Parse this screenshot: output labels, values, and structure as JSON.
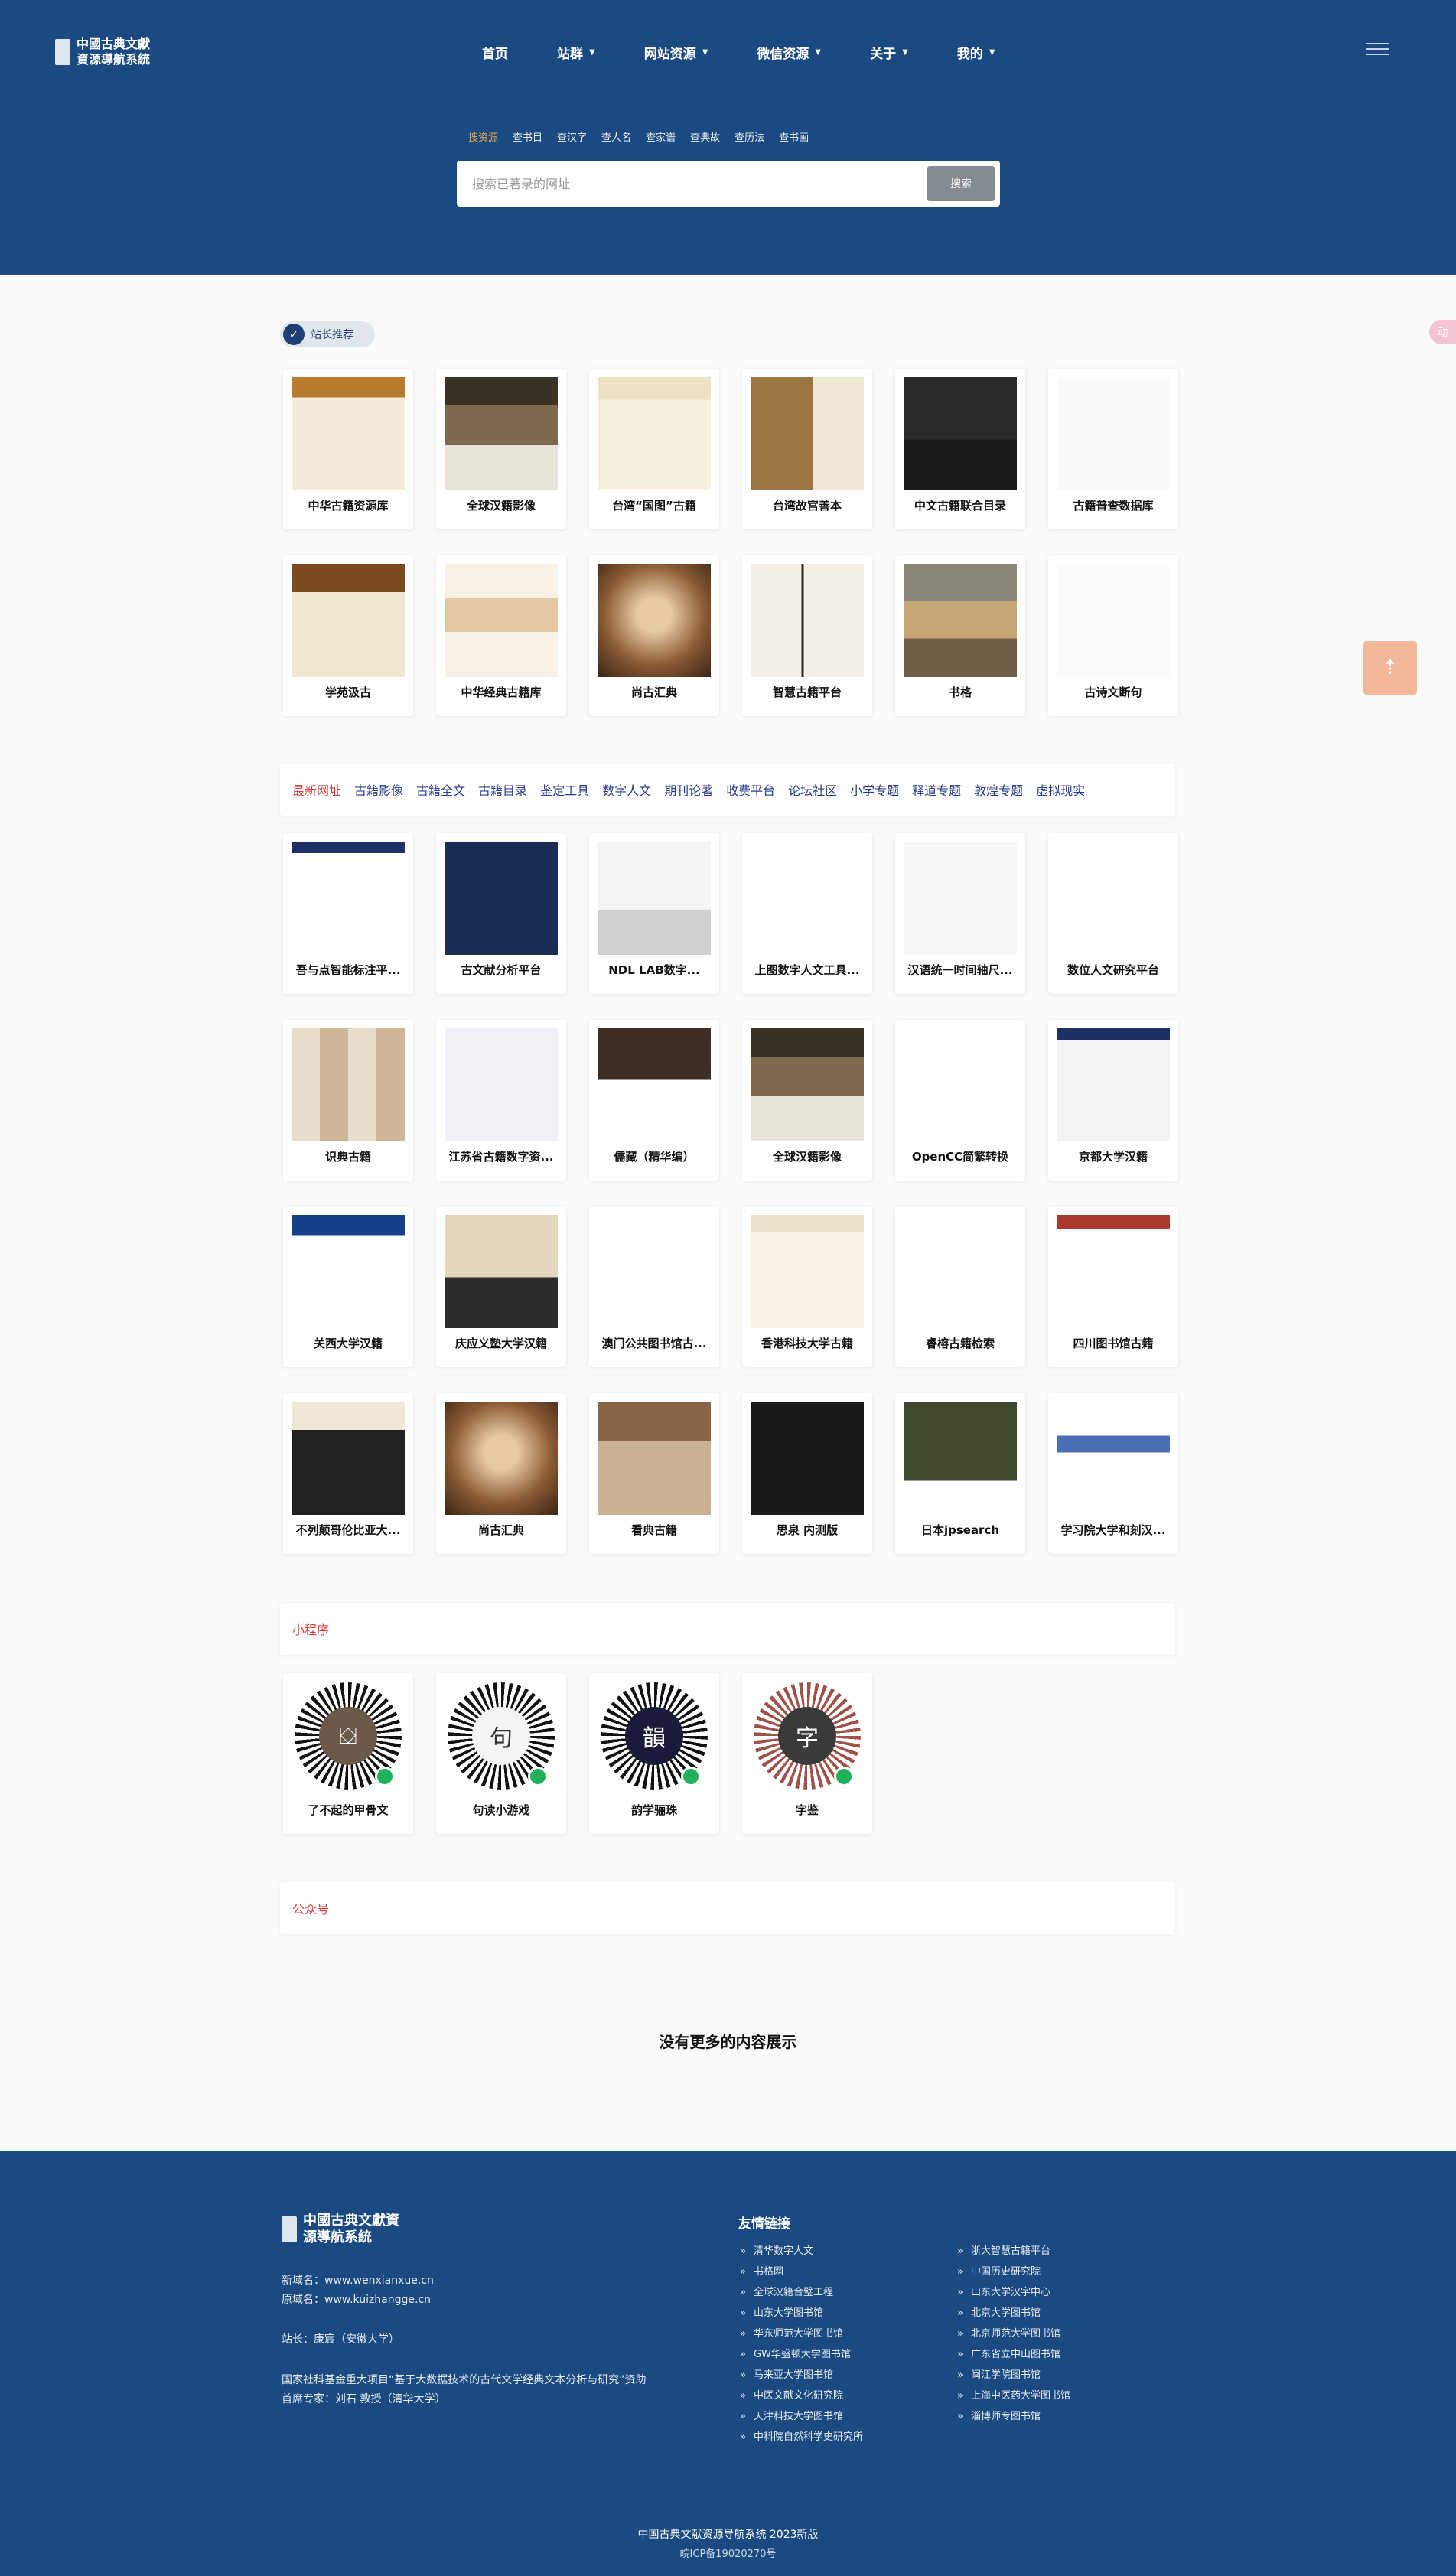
{
  "header": {
    "logo_text": "中國古典文獻資源導航系統",
    "nav": [
      {
        "label": "首页",
        "dropdown": false
      },
      {
        "label": "站群",
        "dropdown": true
      },
      {
        "label": "网站资源",
        "dropdown": true
      },
      {
        "label": "微信资源",
        "dropdown": true
      },
      {
        "label": "关于",
        "dropdown": true
      },
      {
        "label": "我的",
        "dropdown": true
      }
    ],
    "menu_icon": "hamburger-icon"
  },
  "search": {
    "tabs": [
      "搜资源",
      "查书目",
      "查汉字",
      "查人名",
      "查家谱",
      "查典故",
      "查历法",
      "查书画"
    ],
    "active_tab": 0,
    "placeholder": "搜索已著录的网址",
    "button": "搜索"
  },
  "recommend": {
    "badge": "站长推荐",
    "items": [
      "中华古籍资源库",
      "全球汉籍影像",
      "台湾“国图”古籍",
      "台湾故宫善本",
      "中文古籍联合目录",
      "古籍普查数据库",
      "学苑汲古",
      "中华经典古籍库",
      "尚古汇典",
      "智慧古籍平台",
      "书格",
      "古诗文断句"
    ]
  },
  "filters": {
    "tabs": [
      "最新网址",
      "古籍影像",
      "古籍全文",
      "古籍目录",
      "鉴定工具",
      "数字人文",
      "期刊论著",
      "收费平台",
      "论坛社区",
      "小学专题",
      "释道专题",
      "敦煌专题",
      "虚拟现实"
    ],
    "active": 0
  },
  "latest": {
    "items": [
      "吾与点智能标注平...",
      "古文献分析平台",
      "NDL LAB数字...",
      "上图数字人文工具...",
      "汉语统一时间轴尺...",
      "数位人文研究平台",
      "识典古籍",
      "江苏省古籍数字资...",
      "儒藏（精华编）",
      "全球汉籍影像",
      "OpenCC简繁转换",
      "京都大学汉籍",
      "关西大学汉籍",
      "庆应义塾大学汉籍",
      "澳门公共图书馆古...",
      "香港科技大学古籍",
      "睿榕古籍检索",
      "四川图书馆古籍",
      "不列颠哥伦比亚大...",
      "尚古汇典",
      "看典古籍",
      "思泉 内测版",
      "日本jpsearch",
      "学习院大学和刻汉..."
    ]
  },
  "mini": {
    "title": "小程序",
    "items": [
      {
        "label": "了不起的甲骨文",
        "glyph": "⛋",
        "color": "#6b5a4a"
      },
      {
        "label": "句读小游戏",
        "glyph": "句",
        "color": "#ffffff"
      },
      {
        "label": "韵学骊珠",
        "glyph": "韻",
        "color": "#1a1a3a"
      },
      {
        "label": "字鉴",
        "glyph": "字",
        "color": "#3a3a3a"
      }
    ]
  },
  "official": {
    "title": "公众号"
  },
  "no_more": "没有更多的内容展示",
  "footer": {
    "logo_text": "中國古典文獻資源導航系統",
    "lines": [
      "新域名：www.wenxianxue.cn",
      "原域名：www.kuizhangge.cn",
      "站长：康宸（安徽大学）",
      "国家社科基金重大项目“基于大数据技术的古代文学经典文本分析与研究”资助",
      "首席专家：刘石 教授（清华大学）"
    ],
    "links_title": "友情链接",
    "links_left": [
      "清华数字人文",
      "书格网",
      "全球汉籍合璧工程",
      "山东大学图书馆",
      "华东师范大学图书馆",
      "GW华盛顿大学图书馆",
      "马来亚大学图书馆",
      "中医文献文化研究院",
      "天津科技大学图书馆",
      "中科院自然科学史研究所"
    ],
    "links_right": [
      "浙大智慧古籍平台",
      "中国历史研究院",
      "山东大学汉字中心",
      "北京大学图书馆",
      "北京师范大学图书馆",
      "广东省立中山图书馆",
      "闽江学院图书馆",
      "上海中医药大学图书馆",
      "淄博师专图书馆"
    ],
    "copyright": "中国古典文献资源导航系统 2023新版",
    "icp": "皖ICP备19020270号"
  },
  "float": {
    "to_top": "⇡",
    "side": "动"
  }
}
